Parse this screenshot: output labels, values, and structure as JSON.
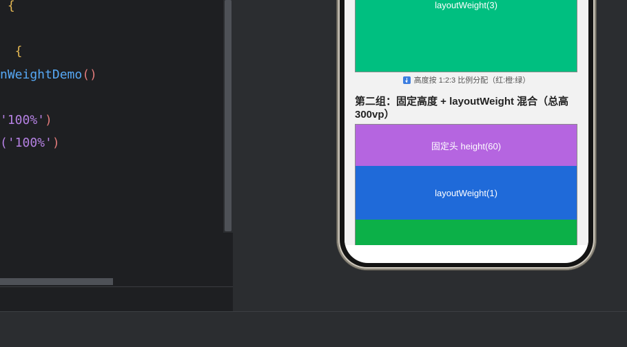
{
  "editor": {
    "lines": [
      [
        {
          "text": " {",
          "cls": "tok-brace"
        }
      ],
      [
        {
          "text": "  {",
          "cls": "tok-brace"
        }
      ],
      [
        {
          "text": "nWeightDemo",
          "cls": "tok-fn"
        },
        {
          "text": "()",
          "cls": "tok-paren"
        }
      ],
      [
        {
          "text": "'100%'",
          "cls": "tok-str"
        },
        {
          "text": ")",
          "cls": "tok-paren"
        }
      ],
      [
        {
          "text": "('100%'",
          "cls": "tok-str"
        },
        {
          "text": ")",
          "cls": "tok-paren"
        }
      ]
    ]
  },
  "preview": {
    "group1": {
      "block3_label": "layoutWeight(3)",
      "block3_color": "#00bf80",
      "caption": "高度按 1:2:3 比例分配（红:橙:绿）",
      "caption_icon": "down-arrow-icon"
    },
    "group2": {
      "title": "第二组：固定高度 + layoutWeight 混合（总高 300vp）",
      "fixed_label": "固定头 height(60)",
      "fixed_color": "#b565e0",
      "weight1_label": "layoutWeight(1)",
      "weight1_color": "#1f6ad9",
      "next_color": "#0cb048"
    }
  }
}
